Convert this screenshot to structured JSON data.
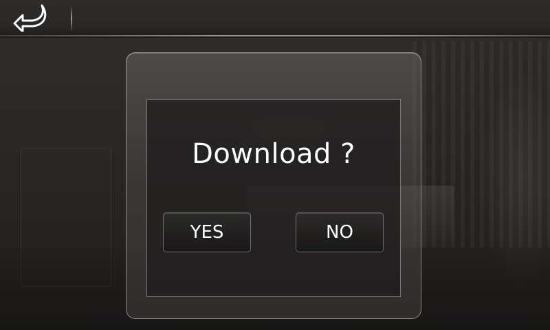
{
  "header": {
    "back_icon": "back-arrow-icon"
  },
  "dialog": {
    "title": "Download ?",
    "yes_label": "YES",
    "no_label": "NO"
  },
  "colors": {
    "text": "#ffffff",
    "panel": "#1c1b1a",
    "border": "#ffffff"
  }
}
